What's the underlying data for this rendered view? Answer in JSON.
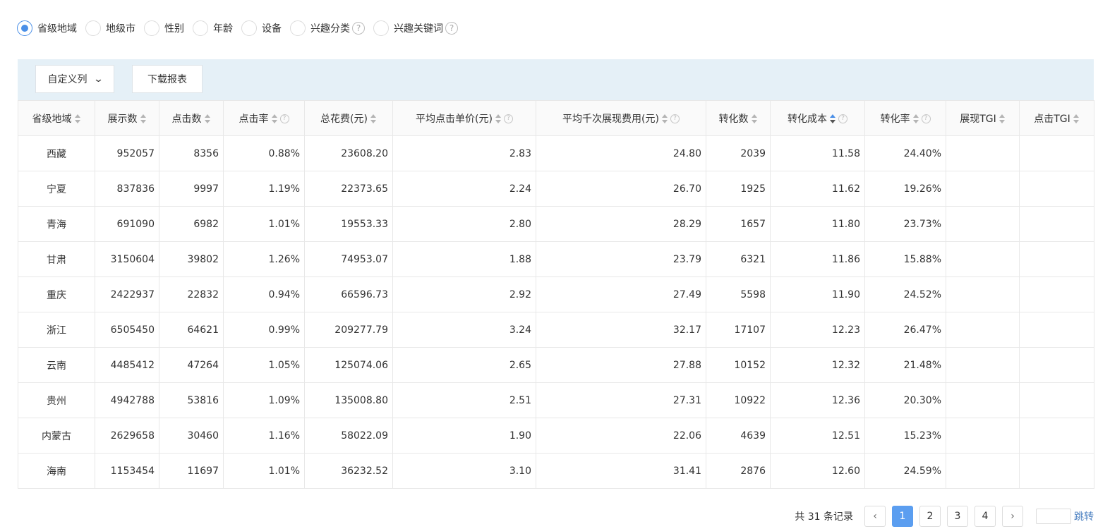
{
  "dimension_options": [
    {
      "label": "省级地域",
      "checked": true,
      "help": false
    },
    {
      "label": "地级市",
      "checked": false,
      "help": false
    },
    {
      "label": "性别",
      "checked": false,
      "help": false
    },
    {
      "label": "年龄",
      "checked": false,
      "help": false
    },
    {
      "label": "设备",
      "checked": false,
      "help": false
    },
    {
      "label": "兴趣分类",
      "checked": false,
      "help": true
    },
    {
      "label": "兴趣关键词",
      "checked": false,
      "help": true
    }
  ],
  "help_glyph": "?",
  "toolbar": {
    "custom_columns_label": "自定义列",
    "download_label": "下载报表"
  },
  "table": {
    "columns": [
      {
        "label": "省级地域",
        "help": false,
        "active_sort": false
      },
      {
        "label": "展示数",
        "help": false,
        "active_sort": false
      },
      {
        "label": "点击数",
        "help": false,
        "active_sort": false
      },
      {
        "label": "点击率",
        "help": true,
        "active_sort": false
      },
      {
        "label": "总花费(元)",
        "help": false,
        "active_sort": false
      },
      {
        "label": "平均点击单价(元)",
        "help": true,
        "active_sort": false
      },
      {
        "label": "平均千次展现费用(元)",
        "help": true,
        "active_sort": false
      },
      {
        "label": "转化数",
        "help": false,
        "active_sort": false
      },
      {
        "label": "转化成本",
        "help": true,
        "active_sort": true
      },
      {
        "label": "转化率",
        "help": true,
        "active_sort": false
      },
      {
        "label": "展现TGI",
        "help": false,
        "active_sort": false
      },
      {
        "label": "点击TGI",
        "help": false,
        "active_sort": false
      }
    ],
    "rows": [
      [
        "西藏",
        "952057",
        "8356",
        "0.88%",
        "23608.20",
        "2.83",
        "24.80",
        "2039",
        "11.58",
        "24.40%",
        "",
        ""
      ],
      [
        "宁夏",
        "837836",
        "9997",
        "1.19%",
        "22373.65",
        "2.24",
        "26.70",
        "1925",
        "11.62",
        "19.26%",
        "",
        ""
      ],
      [
        "青海",
        "691090",
        "6982",
        "1.01%",
        "19553.33",
        "2.80",
        "28.29",
        "1657",
        "11.80",
        "23.73%",
        "",
        ""
      ],
      [
        "甘肃",
        "3150604",
        "39802",
        "1.26%",
        "74953.07",
        "1.88",
        "23.79",
        "6321",
        "11.86",
        "15.88%",
        "",
        ""
      ],
      [
        "重庆",
        "2422937",
        "22832",
        "0.94%",
        "66596.73",
        "2.92",
        "27.49",
        "5598",
        "11.90",
        "24.52%",
        "",
        ""
      ],
      [
        "浙江",
        "6505450",
        "64621",
        "0.99%",
        "209277.79",
        "3.24",
        "32.17",
        "17107",
        "12.23",
        "26.47%",
        "",
        ""
      ],
      [
        "云南",
        "4485412",
        "47264",
        "1.05%",
        "125074.06",
        "2.65",
        "27.88",
        "10152",
        "12.32",
        "21.48%",
        "",
        ""
      ],
      [
        "贵州",
        "4942788",
        "53816",
        "1.09%",
        "135008.80",
        "2.51",
        "27.31",
        "10922",
        "12.36",
        "20.30%",
        "",
        ""
      ],
      [
        "内蒙古",
        "2629658",
        "30460",
        "1.16%",
        "58022.09",
        "1.90",
        "22.06",
        "4639",
        "12.51",
        "15.23%",
        "",
        ""
      ],
      [
        "海南",
        "1153454",
        "11697",
        "1.01%",
        "36232.52",
        "3.10",
        "31.41",
        "2876",
        "12.60",
        "24.59%",
        "",
        ""
      ]
    ]
  },
  "pagination": {
    "total_text": "共 31 条记录",
    "prev_label": "‹",
    "next_label": "›",
    "pages": [
      "1",
      "2",
      "3",
      "4"
    ],
    "current_page": "1",
    "jump_label": "跳转"
  },
  "colors": {
    "accent": "#4a8fe7",
    "toolbar_bg": "#e5f0f7",
    "active_page_bg": "#5b9ef0",
    "link": "#4a7fc0"
  }
}
